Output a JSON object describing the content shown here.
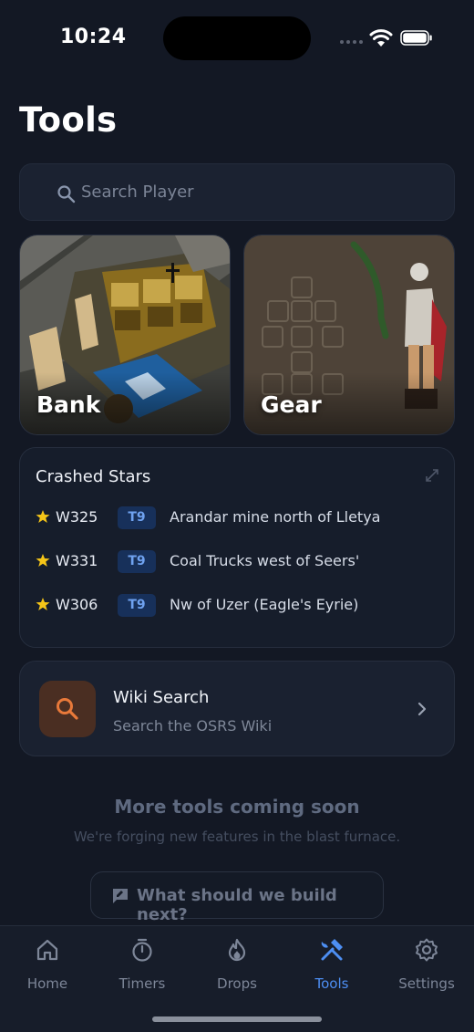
{
  "status_bar": {
    "time": "10:24"
  },
  "page": {
    "title": "Tools"
  },
  "search": {
    "placeholder": "Search Player"
  },
  "cards": [
    {
      "label": "Bank"
    },
    {
      "label": "Gear"
    }
  ],
  "crashed_stars": {
    "title": "Crashed Stars",
    "rows": [
      {
        "world": "W325",
        "tier": "T9",
        "location": "Arandar mine north of Lletya"
      },
      {
        "world": "W331",
        "tier": "T9",
        "location": "Coal Trucks west of Seers'"
      },
      {
        "world": "W306",
        "tier": "T9",
        "location": "Nw of Uzer (Eagle's Eyrie)"
      }
    ]
  },
  "wiki": {
    "title": "Wiki Search",
    "subtitle": "Search the OSRS Wiki"
  },
  "coming_soon": {
    "title": "More tools coming soon",
    "subtitle": "We're forging new features in the blast furnace.",
    "button_label": "What should we build next?"
  },
  "tabbar": {
    "items": [
      {
        "label": "Home",
        "icon": "home-icon"
      },
      {
        "label": "Timers",
        "icon": "timer-icon"
      },
      {
        "label": "Drops",
        "icon": "flame-icon"
      },
      {
        "label": "Tools",
        "icon": "tools-icon",
        "active": true
      },
      {
        "label": "Settings",
        "icon": "gear-icon"
      }
    ]
  },
  "colors": {
    "background": "#131824",
    "accent": "#4d8ef2",
    "star": "#f5c518",
    "wiki_accent": "#e8793a"
  }
}
